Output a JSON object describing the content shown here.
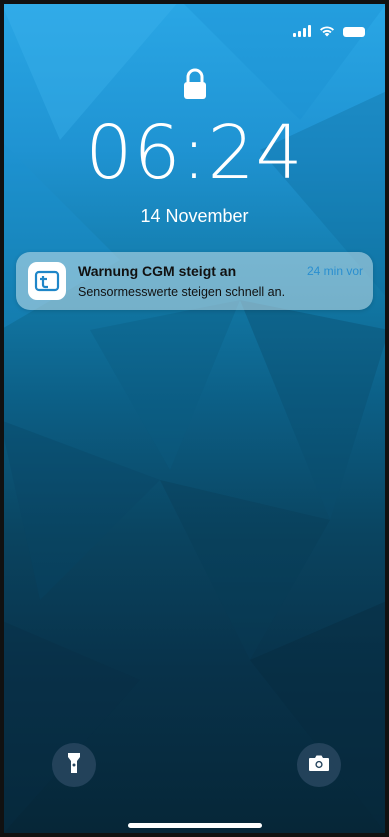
{
  "status_bar": {
    "signal_icon": "cellular-signal-icon",
    "wifi_icon": "wifi-icon",
    "battery_icon": "battery-icon"
  },
  "lock_screen": {
    "lock_icon": "lock-icon",
    "time": "06:24",
    "date": "14 November"
  },
  "notification": {
    "app_icon": "cgm-app-icon",
    "title": "Warnung CGM steigt an",
    "time_ago": "24 min vor",
    "body": "Sensormesswerte steigen schnell an."
  },
  "quick_actions": {
    "flashlight_icon": "flashlight-icon",
    "camera_icon": "camera-icon"
  },
  "colors": {
    "accent": "#2a8fd0",
    "background_top": "#2aa7e6",
    "background_bottom": "#062637"
  }
}
